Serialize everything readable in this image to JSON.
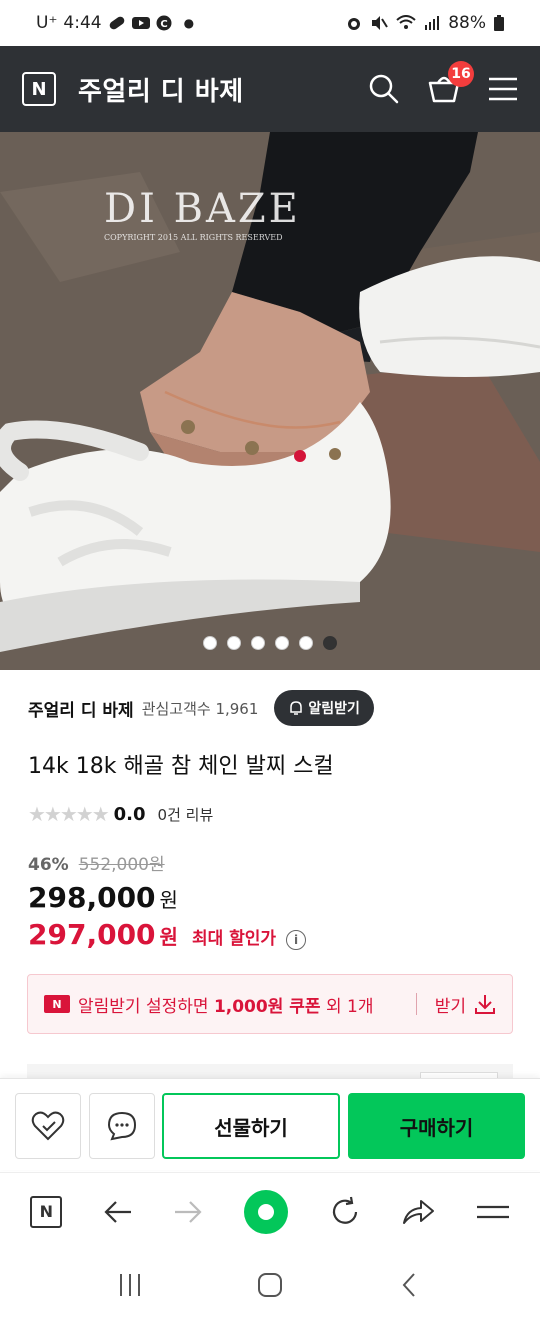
{
  "status_bar": {
    "carrier": "U⁺",
    "time": "4:44",
    "battery": "88%"
  },
  "header": {
    "logo": "N",
    "title": "주얼리 디 바제",
    "cart_count": "16"
  },
  "photo": {
    "watermark": "DI BAZE",
    "watermark_sub": "COPYRIGHT 2015 ALL RIGHTS RESERVED",
    "dots_total": 6,
    "dots_active_index": 5
  },
  "seller": {
    "name": "주얼리 디 바제",
    "followers": "관심고객수 1,961",
    "alarm_label": "알림받기"
  },
  "product": {
    "title": "14k 18k 해골 참 체인 발찌 스컬",
    "rating": "0.0",
    "reviews": "0건 리뷰",
    "discount_rate": "46%",
    "original_price": "552,000원",
    "sale_price": "298,000",
    "max_price": "297,000",
    "price_unit": "원",
    "max_label": "최대 할인가"
  },
  "coupon": {
    "badge": "N",
    "text_pre": "알림받기 설정하면 ",
    "text_bold": "1,000원 쿠폰",
    "text_post": " 외 1개",
    "get_label": "받기"
  },
  "actions": {
    "gift_label": "선물하기",
    "buy_label": "구매하기"
  },
  "browser_nav": {
    "logo": "N"
  },
  "colors": {
    "header_bg": "#2e3135",
    "naver_green": "#03c75a",
    "sale_red": "#d9143a",
    "badge_red": "#f33d3d"
  }
}
